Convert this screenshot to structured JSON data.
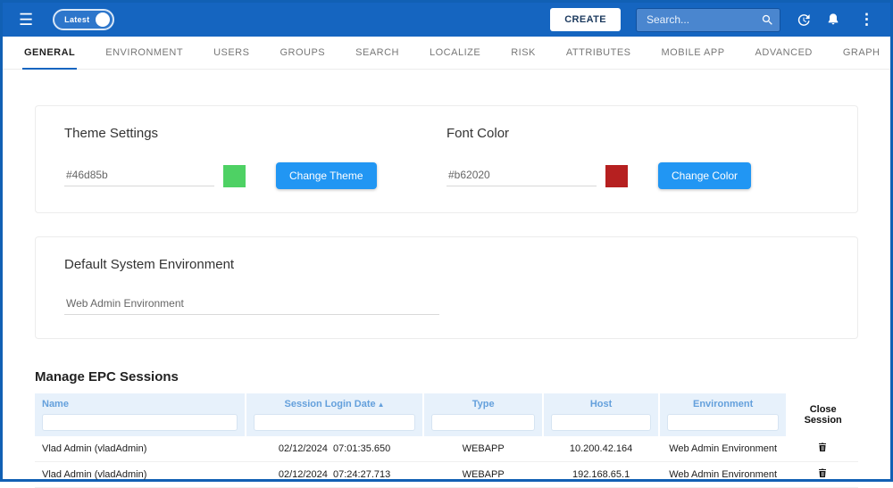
{
  "topbar": {
    "menu_icon": "☰",
    "toggle_label": "Latest",
    "create_button": "CREATE",
    "search_placeholder": "Search...",
    "kebab_icon": "⋮"
  },
  "tabs": [
    {
      "label": "GENERAL",
      "active": true
    },
    {
      "label": "ENVIRONMENT"
    },
    {
      "label": "USERS"
    },
    {
      "label": "GROUPS"
    },
    {
      "label": "SEARCH"
    },
    {
      "label": "LOCALIZE"
    },
    {
      "label": "RISK"
    },
    {
      "label": "ATTRIBUTES"
    },
    {
      "label": "MOBILE APP"
    },
    {
      "label": "ADVANCED"
    },
    {
      "label": "GRAPH"
    }
  ],
  "theme_settings": {
    "title": "Theme Settings",
    "value": "#46d85b",
    "swatch_color": "#4ed164",
    "button": "Change Theme"
  },
  "font_color": {
    "title": "Font Color",
    "value": "#b62020",
    "swatch_color": "#b62020",
    "button": "Change Color"
  },
  "default_environment": {
    "title": "Default System Environment",
    "value": "Web Admin Environment"
  },
  "sessions": {
    "title": "Manage EPC Sessions",
    "columns": [
      "Name",
      "Session Login Date",
      "Type",
      "Host",
      "Environment",
      "Close Session"
    ],
    "sort_column": "Session Login Date",
    "sort_indicator": "▲",
    "rows": [
      {
        "name": "Vlad Admin (vladAdmin)",
        "login_date": "02/12/2024  07:01:35.650",
        "type": "WEBAPP",
        "host": "10.200.42.164",
        "environment": "Web Admin Environment"
      },
      {
        "name": "Vlad Admin (vladAdmin)",
        "login_date": "02/12/2024  07:24:27.713",
        "type": "WEBAPP",
        "host": "192.168.65.1",
        "environment": "Web Admin Environment"
      }
    ]
  },
  "colors": {
    "topbar_blue": "#1565c0",
    "accent_button_blue": "#2196f3",
    "table_header_bg": "#e7f1fb",
    "table_header_text": "#64a0dc"
  }
}
